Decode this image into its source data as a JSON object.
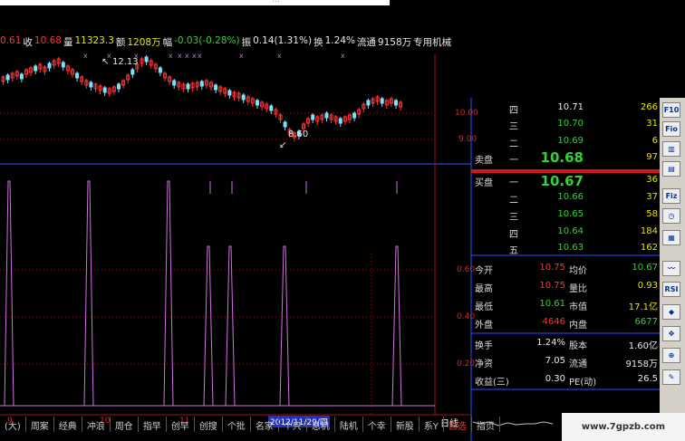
{
  "title_fragment": "…",
  "header": {
    "open_val": "0.61",
    "close_label": "收",
    "close_val": "10.68",
    "volume_label": "量",
    "volume_val": "11323.3",
    "amount_label": "额",
    "amount_val": "1208万",
    "range_label": "幅",
    "range_val": "-0.03(-0.28%)",
    "swing_label": "振",
    "swing_val": "0.14(1.31%)",
    "turnover_label": "换",
    "turnover_val": "1.24%",
    "float_label": "流通",
    "float_val": "9158万",
    "sector": "专用机械"
  },
  "main_chart": {
    "high_marker": "12.13",
    "low_marker": "8.60",
    "axis_ticks": [
      "10.00",
      "9.00"
    ]
  },
  "indicator_chart": {
    "axis_ticks": [
      "0.60",
      "0.40",
      "0.20"
    ]
  },
  "date_axis": {
    "labels": [
      "9",
      "10",
      "11",
      "12"
    ],
    "current_date": "2012/11/29/四"
  },
  "period_label": "日线",
  "order_book": {
    "asks": [
      {
        "label": "四",
        "price": "10.71",
        "volume": "266"
      },
      {
        "label": "三",
        "price": "10.70",
        "volume": "31"
      },
      {
        "label": "二",
        "price": "10.69",
        "volume": "6"
      },
      {
        "label": "一",
        "price": "10.68",
        "volume": "97"
      }
    ],
    "ask_side": "卖盘",
    "bid_side": "买盘",
    "bids": [
      {
        "label": "一",
        "price": "10.67",
        "volume": "36"
      },
      {
        "label": "二",
        "price": "10.66",
        "volume": "37"
      },
      {
        "label": "三",
        "price": "10.65",
        "volume": "58"
      },
      {
        "label": "四",
        "price": "10.64",
        "volume": "184"
      },
      {
        "label": "五",
        "price": "10.63",
        "volume": "162"
      }
    ]
  },
  "quote": {
    "open_label": "今开",
    "open": "10.75",
    "avg_label": "均价",
    "avg": "10.67",
    "high_label": "最高",
    "high": "10.75",
    "vol_ratio_label": "量比",
    "vol_ratio": "0.93",
    "low_label": "最低",
    "low": "10.61",
    "mktcap_label": "市值",
    "mktcap": "17.1亿",
    "outer_label": "外盘",
    "outer": "4646",
    "inner_label": "内盘",
    "inner": "6677",
    "turnover_label": "换手",
    "turnover": "1.24%",
    "shares_label": "股本",
    "shares": "1.60亿",
    "netasset_label": "净资",
    "netasset": "7.05",
    "float_label": "流通",
    "float": "9158万",
    "eps_label": "收益(三)",
    "eps": "0.30",
    "pe_label": "PE(动)",
    "pe": "26.5"
  },
  "bottom_tabs": [
    "(大)",
    "周案",
    "经典",
    "冲浪",
    "周仓",
    "指早",
    "创早",
    "创搜",
    "个批",
    "名家",
    "个只",
    "息机",
    "陆机",
    "个幸",
    "新股",
    "系Y",
    "自选",
    "指页"
  ],
  "watermark": "www.7gpzb.com",
  "toolbar_icons": [
    "F10-icon",
    "F10-icon",
    "chart-icon",
    "F10-icon",
    "F12-icon",
    "clock-icon",
    "chart-icon",
    "wave-icon",
    "RSI-icon",
    "marker-icon",
    "move-icon",
    "zoom-icon",
    "pencil-icon"
  ],
  "colors": {
    "up": "#ff3232",
    "down": "#34d134",
    "indicator": "#d070e0",
    "axis": "#a01010"
  }
}
